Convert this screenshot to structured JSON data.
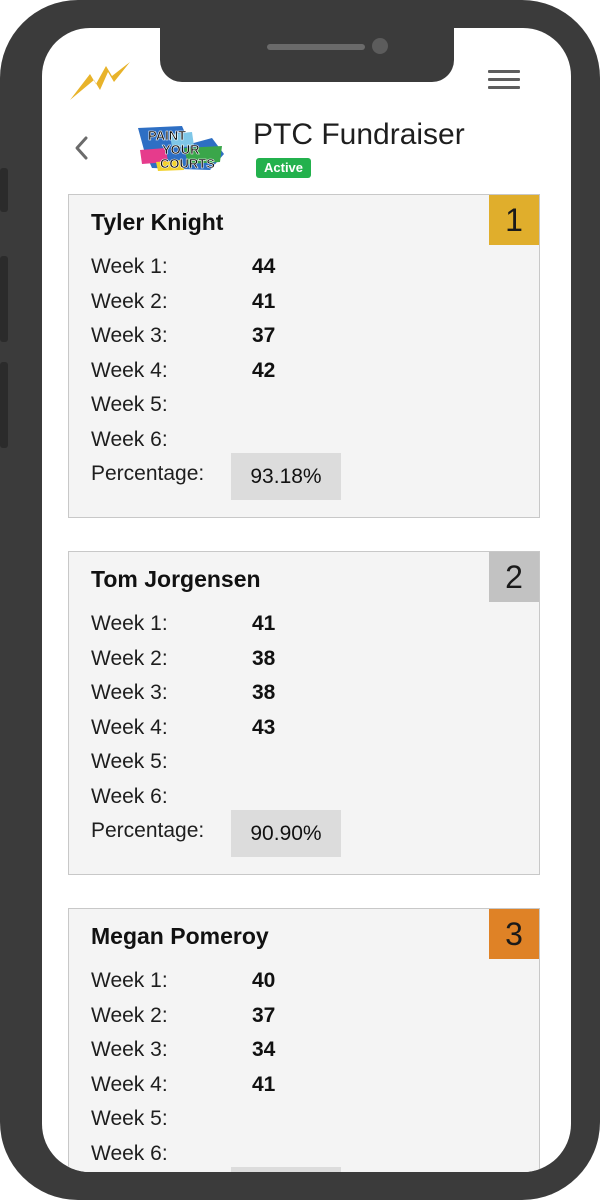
{
  "header": {
    "title": "PTC Fundraiser",
    "status": "Active",
    "event_logo_text": [
      "PAINT",
      "YOUR",
      "COURTS"
    ]
  },
  "icons": {
    "app_logo": "lightning-bolt-icon",
    "menu": "hamburger-menu-icon",
    "back": "chevron-left-icon"
  },
  "colors": {
    "gold": "#e0ae2c",
    "silver": "#c2c2c2",
    "bronze": "#df8226",
    "active_green": "#23b14d",
    "card_bg": "#f4f4f4"
  },
  "labels": {
    "week1": "Week 1:",
    "week2": "Week 2:",
    "week3": "Week 3:",
    "week4": "Week 4:",
    "week5": "Week 5:",
    "week6": "Week 6:",
    "percentage": "Percentage:"
  },
  "leaderboard": [
    {
      "rank": "1",
      "name": "Tyler Knight",
      "weeks": [
        "44",
        "41",
        "37",
        "42",
        "",
        ""
      ],
      "percentage": "93.18%"
    },
    {
      "rank": "2",
      "name": "Tom Jorgensen",
      "weeks": [
        "41",
        "38",
        "38",
        "43",
        "",
        ""
      ],
      "percentage": "90.90%"
    },
    {
      "rank": "3",
      "name": "Megan Pomeroy",
      "weeks": [
        "40",
        "37",
        "34",
        "41",
        "",
        ""
      ],
      "percentage": ""
    }
  ]
}
